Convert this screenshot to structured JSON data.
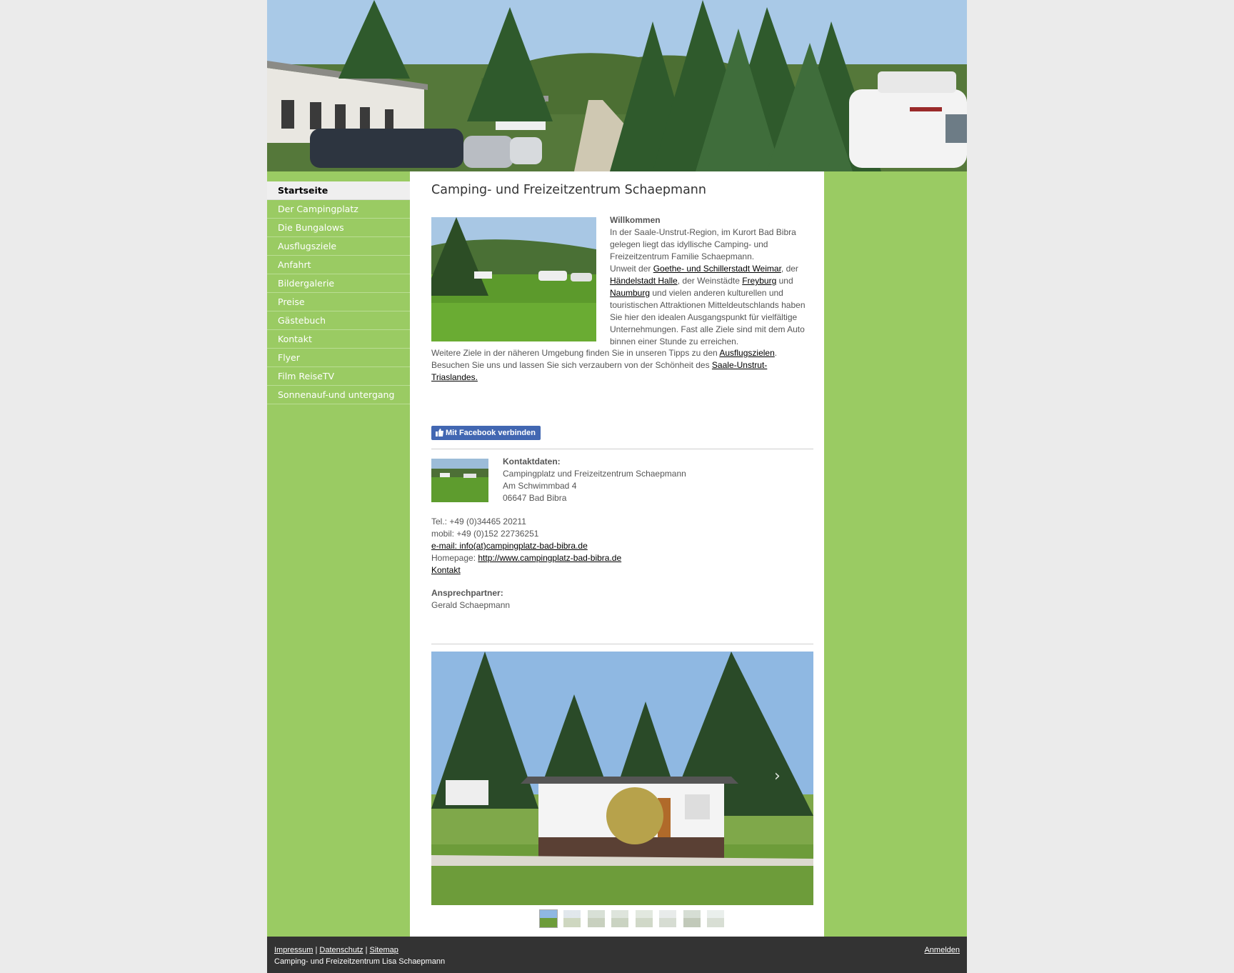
{
  "nav": {
    "items": [
      {
        "label": "Startseite",
        "active": true
      },
      {
        "label": "Der Campingplatz"
      },
      {
        "label": "Die Bungalows"
      },
      {
        "label": "Ausflugsziele"
      },
      {
        "label": "Anfahrt"
      },
      {
        "label": "Bildergalerie"
      },
      {
        "label": "Preise"
      },
      {
        "label": "Gästebuch"
      },
      {
        "label": "Kontakt"
      },
      {
        "label": "Flyer"
      },
      {
        "label": "Film ReiseTV"
      },
      {
        "label": "Sonnenauf-und untergang"
      }
    ]
  },
  "main": {
    "title": "Camping- und Freizeitzentrum Schaepmann",
    "welcome_heading": "Willkommen",
    "welcome_p1": "In der Saale-Unstrut-Region, im Kurort Bad Bibra gelegen liegt das idyllische Camping- und Freizeitzentrum Familie Schaepmann.",
    "welcome_p2_start": "Unweit der ",
    "link_weimar": "Goethe- und Schillerstadt Weimar",
    "welcome_p2_a": ", der ",
    "link_halle": "Händelstadt Halle",
    "welcome_p2_b": ", der Weinstädte ",
    "link_freyburg": "Freyburg",
    "welcome_p2_c": " und ",
    "link_naumburg": "Naumburg",
    "welcome_p2_end": " und vielen anderen kulturellen und touristischen Attraktionen Mitteldeutschlands haben Sie hier den idealen Ausgangspunkt für vielfältige Unternehmungen. Fast alle Ziele sind mit dem Auto binnen einer Stunde zu erreichen.",
    "more_p1_start": "Weitere Ziele in der näheren Umgebung finden Sie in unseren Tipps zu den ",
    "link_ausflugsziele": "Ausflugszielen",
    "more_p1_end": ".",
    "more_p2_start": "Besuchen Sie uns und lassen Sie sich verzaubern von der Schönheit des ",
    "link_trias": "Saale-Unstrut-Triaslandes.",
    "facebook_button": "Mit Facebook verbinden"
  },
  "contact": {
    "heading": "Kontaktdaten:",
    "name": "Campingplatz und Freizeitzentrum Schaepmann",
    "street": "Am Schwimmbad 4",
    "city": "06647 Bad Bibra",
    "tel": "Tel.: +49 (0)34465 20211",
    "mobile": "mobil: +49 (0)152 22736251",
    "email": "e-mail: info(at)campingplatz-bad-bibra.de",
    "homepage_label": "Homepage: ",
    "homepage_url": "http://www.campingplatz-bad-bibra.de",
    "contact_link": "Kontakt",
    "partner_heading": "Ansprechpartner:",
    "partner_name": "Gerald Schaepmann"
  },
  "slideshow": {
    "next_icon": "chevron-right-icon",
    "thumb_count": 8,
    "active_thumb": 0
  },
  "footer": {
    "impressum": "Impressum",
    "datenschutz": "Datenschutz",
    "sitemap": "Sitemap",
    "separator": "|",
    "copyright": "Camping- und Freizeitzentrum Lisa Schaepmann",
    "login": "Anmelden"
  },
  "colors": {
    "page_bg": "#ebebeb",
    "sidebar_green": "#9acb63",
    "footer_bg": "#333333",
    "facebook_blue": "#4267b2"
  }
}
